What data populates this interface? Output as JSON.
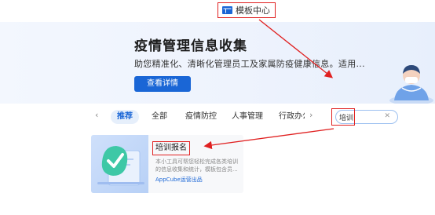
{
  "header": {
    "title": "模板中心",
    "title_icon": "grid-icon"
  },
  "banner": {
    "title": "疫情管理信息收集",
    "description": "助您精准化、清晰化管理员工及家属防疫健康信息。适用...",
    "button_label": "查看详情"
  },
  "tabs": {
    "prev_icon": "chevron-left-icon",
    "next_icon": "chevron-right-icon",
    "items": [
      {
        "label": "推荐",
        "active": true
      },
      {
        "label": "全部",
        "active": false
      },
      {
        "label": "疫情防控",
        "active": false
      },
      {
        "label": "人事管理",
        "active": false
      },
      {
        "label": "行政办公",
        "active": false
      }
    ]
  },
  "search": {
    "value": "培训",
    "clear_icon": "close-icon"
  },
  "card": {
    "title": "培训报名",
    "description_lines": [
      "本小工具可帮您轻松完成各类培训",
      "的信息收集和统计，模板包含员..."
    ],
    "source": "AppCube运营出品"
  },
  "colors": {
    "accent": "#1a66d6",
    "annotation": "#e02020",
    "active_tab_bg": "#e6effb"
  }
}
